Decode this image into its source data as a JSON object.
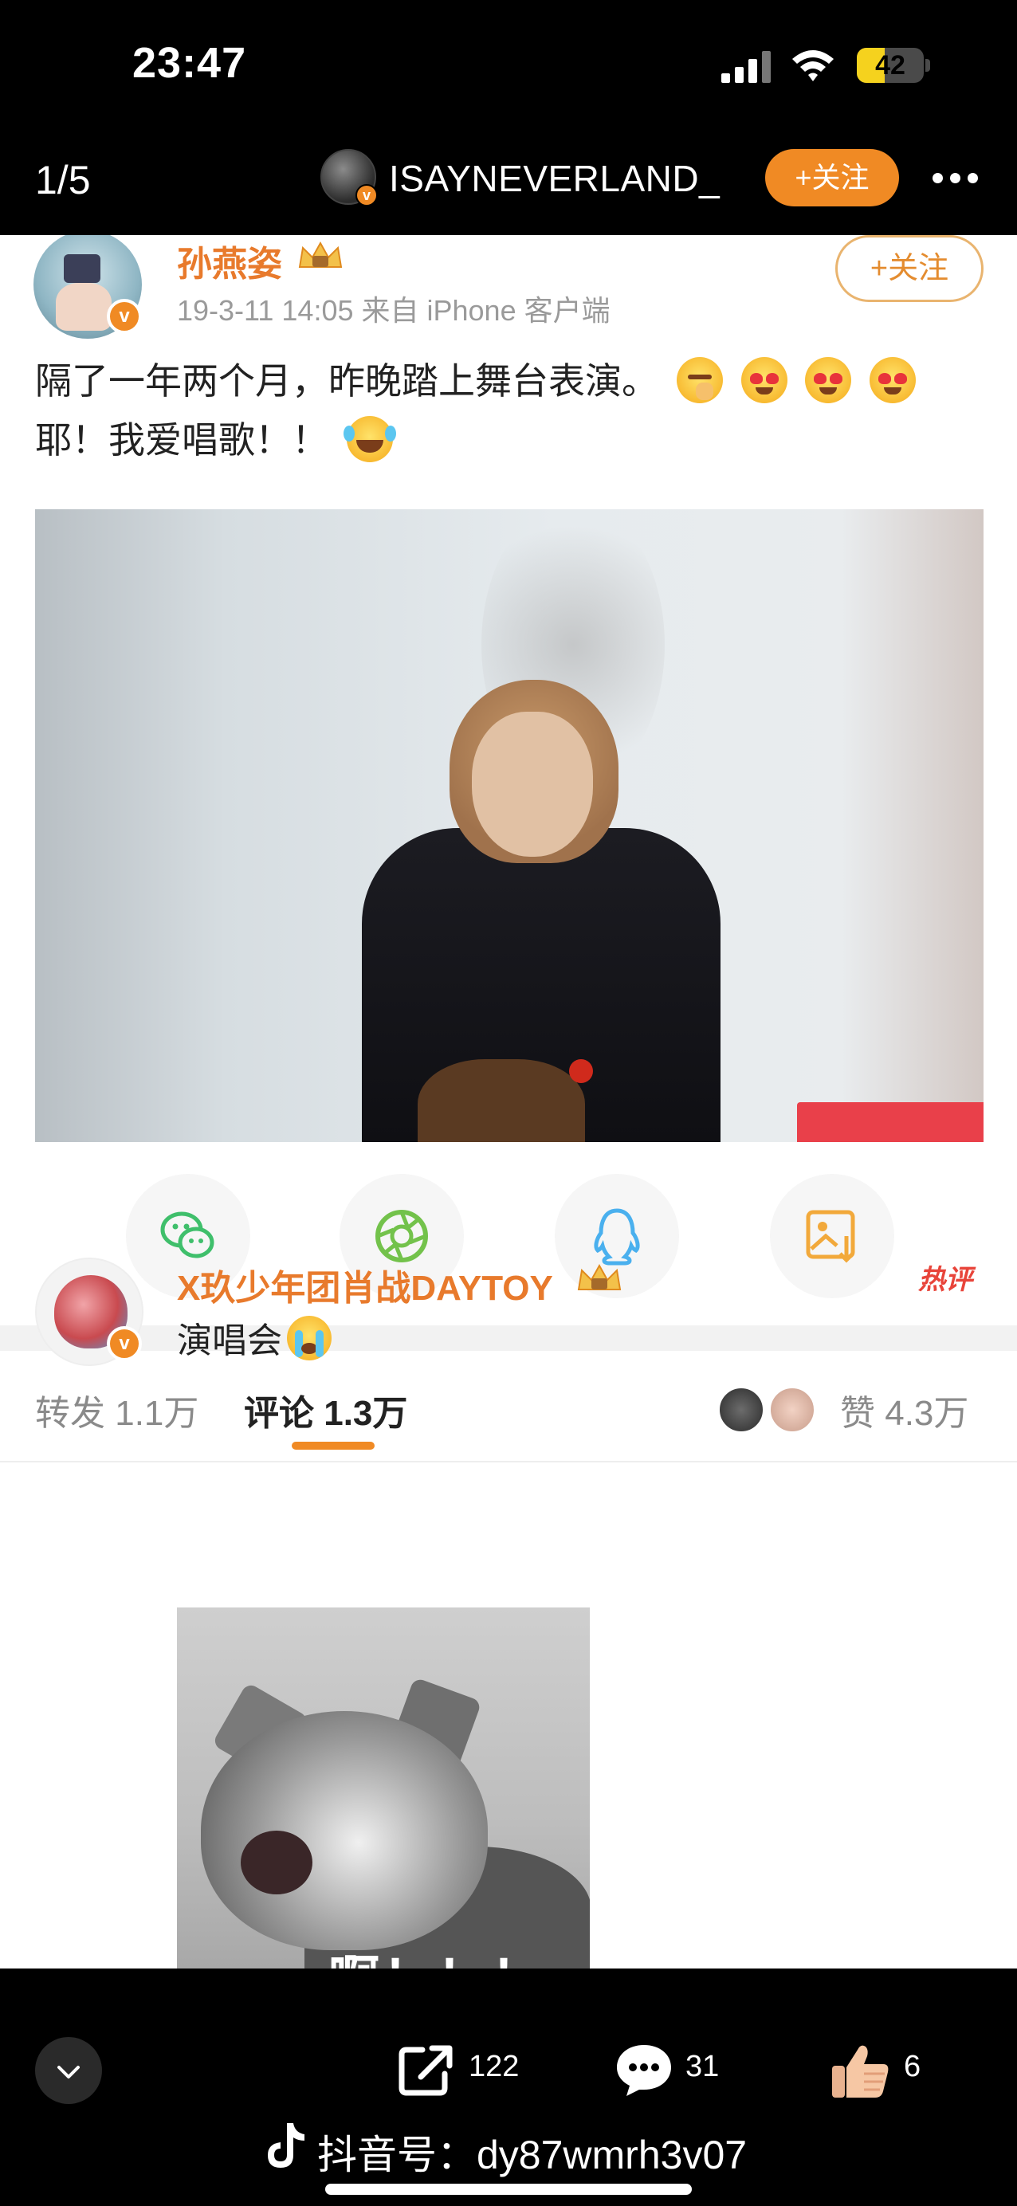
{
  "status_bar": {
    "time": "23:47",
    "battery": "42",
    "battery_level": 0.42
  },
  "header": {
    "page_counter": "1/5",
    "author_name": "ISAYNEVERLAND_",
    "follow_label": "+关注"
  },
  "post": {
    "poster_name": "孙燕姿",
    "meta": "19-3-11 14:05  来自 iPhone 客户端",
    "follow_label": "+关注",
    "text_line1": "隔了一年两个月，昨晚踏上舞台表演。",
    "text_line2": "耶！我爱唱歌！！",
    "emojis": [
      "shh-emoji",
      "heart-eyes-emoji",
      "heart-eyes-emoji",
      "heart-eyes-emoji",
      "laugh-cry-emoji"
    ]
  },
  "share_targets": [
    "wechat-icon",
    "moments-icon",
    "qq-icon",
    "save-image-icon"
  ],
  "tabs": {
    "repost": "转发 1.1万",
    "comments": "评论 1.3万",
    "likes": "赞 4.3万"
  },
  "comment": {
    "name": "X玖少年团肖战DAYTOY",
    "badge": "热评",
    "text": "演唱会",
    "image_caption": "啊！！！"
  },
  "bottom_bar": {
    "share_count": "122",
    "comment_count": "31",
    "like_count": "6",
    "watermark": "抖音号：dy87wmrh3v07"
  },
  "colors": {
    "accent": "#f08a24",
    "name_orange": "#e87a2c",
    "wechat_green": "#3fbf6b",
    "moments_green": "#73c24b",
    "qq_blue": "#4ab0ee",
    "save_yellow": "#f2a93b"
  }
}
